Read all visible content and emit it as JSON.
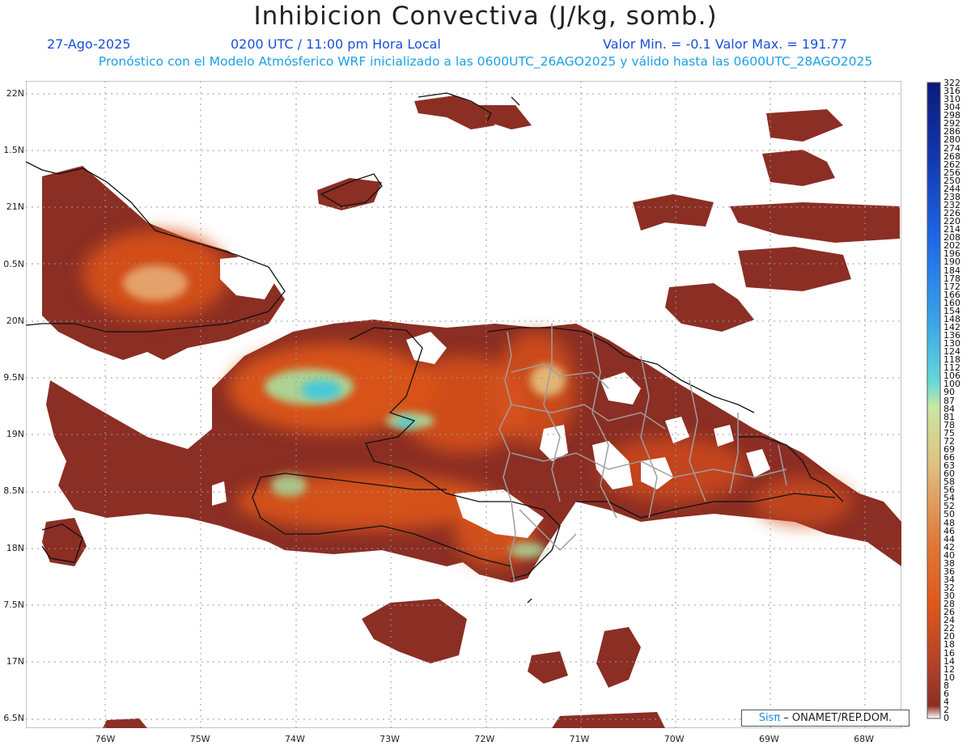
{
  "header": {
    "title": "Inhibicion Convectiva (J/kg, somb.)",
    "date": "27-Ago-2025",
    "time": "0200 UTC / 11:00 pm Hora Local",
    "minmax": "Valor Min. = -0.1  Valor Max. = 191.77",
    "model_info": "Pronóstico con el Modelo Atmósferico WRF inicializado a las 0600UTC_26AGO2025 y válido hasta las  0600UTC_28AGO2025"
  },
  "axes": {
    "lat_labels": [
      "22N",
      "1.5N",
      "21N",
      "0.5N",
      "20N",
      "9.5N",
      "19N",
      "8.5N",
      "18N",
      "7.5N",
      "17N",
      "6.5N"
    ],
    "lon_labels": [
      "76W",
      "75W",
      "74W",
      "73W",
      "72W",
      "71W",
      "70W",
      "69W",
      "68W"
    ]
  },
  "colorbar": {
    "labels": [
      "322",
      "316",
      "310",
      "304",
      "298",
      "292",
      "286",
      "280",
      "274",
      "268",
      "262",
      "256",
      "250",
      "244",
      "238",
      "232",
      "226",
      "220",
      "214",
      "208",
      "202",
      "196",
      "190",
      "184",
      "178",
      "172",
      "166",
      "160",
      "154",
      "148",
      "142",
      "136",
      "130",
      "124",
      "118",
      "112",
      "106",
      "100",
      "90",
      "87",
      "84",
      "81",
      "78",
      "75",
      "72",
      "69",
      "66",
      "63",
      "60",
      "58",
      "56",
      "54",
      "52",
      "50",
      "48",
      "46",
      "44",
      "42",
      "40",
      "38",
      "36",
      "34",
      "32",
      "30",
      "28",
      "26",
      "24",
      "22",
      "20",
      "18",
      "16",
      "14",
      "12",
      "10",
      "8",
      "6",
      "4",
      "2",
      "0"
    ]
  },
  "credit": {
    "sis": "Sisπ",
    "rest": " – ONAMET/REP.DOM."
  },
  "colors": {
    "low": "#8b2e24",
    "mid": "#e0581a",
    "high": "#9fd9a5",
    "max": "#4ac8d8",
    "top": "#0a1a7a"
  }
}
